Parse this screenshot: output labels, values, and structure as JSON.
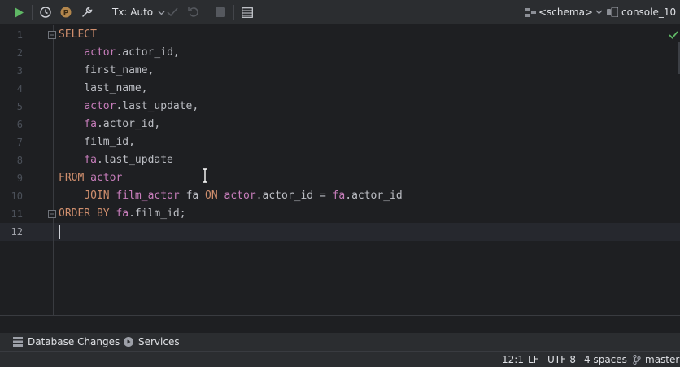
{
  "toolbar": {
    "run_icon": "play-icon",
    "history_icon": "clock-icon",
    "profile_icon": "p-circle-icon",
    "settings_icon": "wrench-icon",
    "tx_label": "Tx: Auto",
    "commit_icon": "checkmark-icon",
    "rollback_icon": "undo-icon",
    "stop_icon": "stop-icon",
    "grid_icon": "table-icon",
    "schema_label": "<schema>",
    "console_label": "console_10"
  },
  "editor": {
    "line_numbers": [
      "1",
      "2",
      "3",
      "4",
      "5",
      "6",
      "7",
      "8",
      "9",
      "10",
      "11",
      "12"
    ],
    "active_line": "12",
    "code": {
      "l1_kw": "SELECT",
      "l2_tbl": "actor",
      "l2_rest": ".actor_id,",
      "l3": "first_name,",
      "l4": "last_name,",
      "l5_tbl": "actor",
      "l5_rest": ".last_update,",
      "l6_tbl": "fa",
      "l6_rest": ".actor_id,",
      "l7": "film_id,",
      "l8_tbl": "fa",
      "l8_rest": ".last_update",
      "l9_kw": "FROM",
      "l9_tbl": "actor",
      "l10_kw": "JOIN",
      "l10_tbl": "film_actor",
      "l10_alias": "fa",
      "l10_on": "ON",
      "l10_a": "actor",
      "l10_b": ".actor_id = ",
      "l10_c": "fa",
      "l10_d": ".actor_id",
      "l11_kw": "ORDER BY",
      "l11_tbl": "fa",
      "l11_rest": ".film_id;"
    }
  },
  "tool_windows": {
    "db_changes": "Database Changes",
    "services": "Services"
  },
  "status_bar": {
    "position": "12:1",
    "line_sep": "LF",
    "encoding": "UTF-8",
    "indent": "4 spaces",
    "branch": "master"
  },
  "colors": {
    "keyword": "#cf8e6d",
    "identifier": "#c77dbb",
    "run": "#5fb865",
    "check": "#5fb865"
  }
}
